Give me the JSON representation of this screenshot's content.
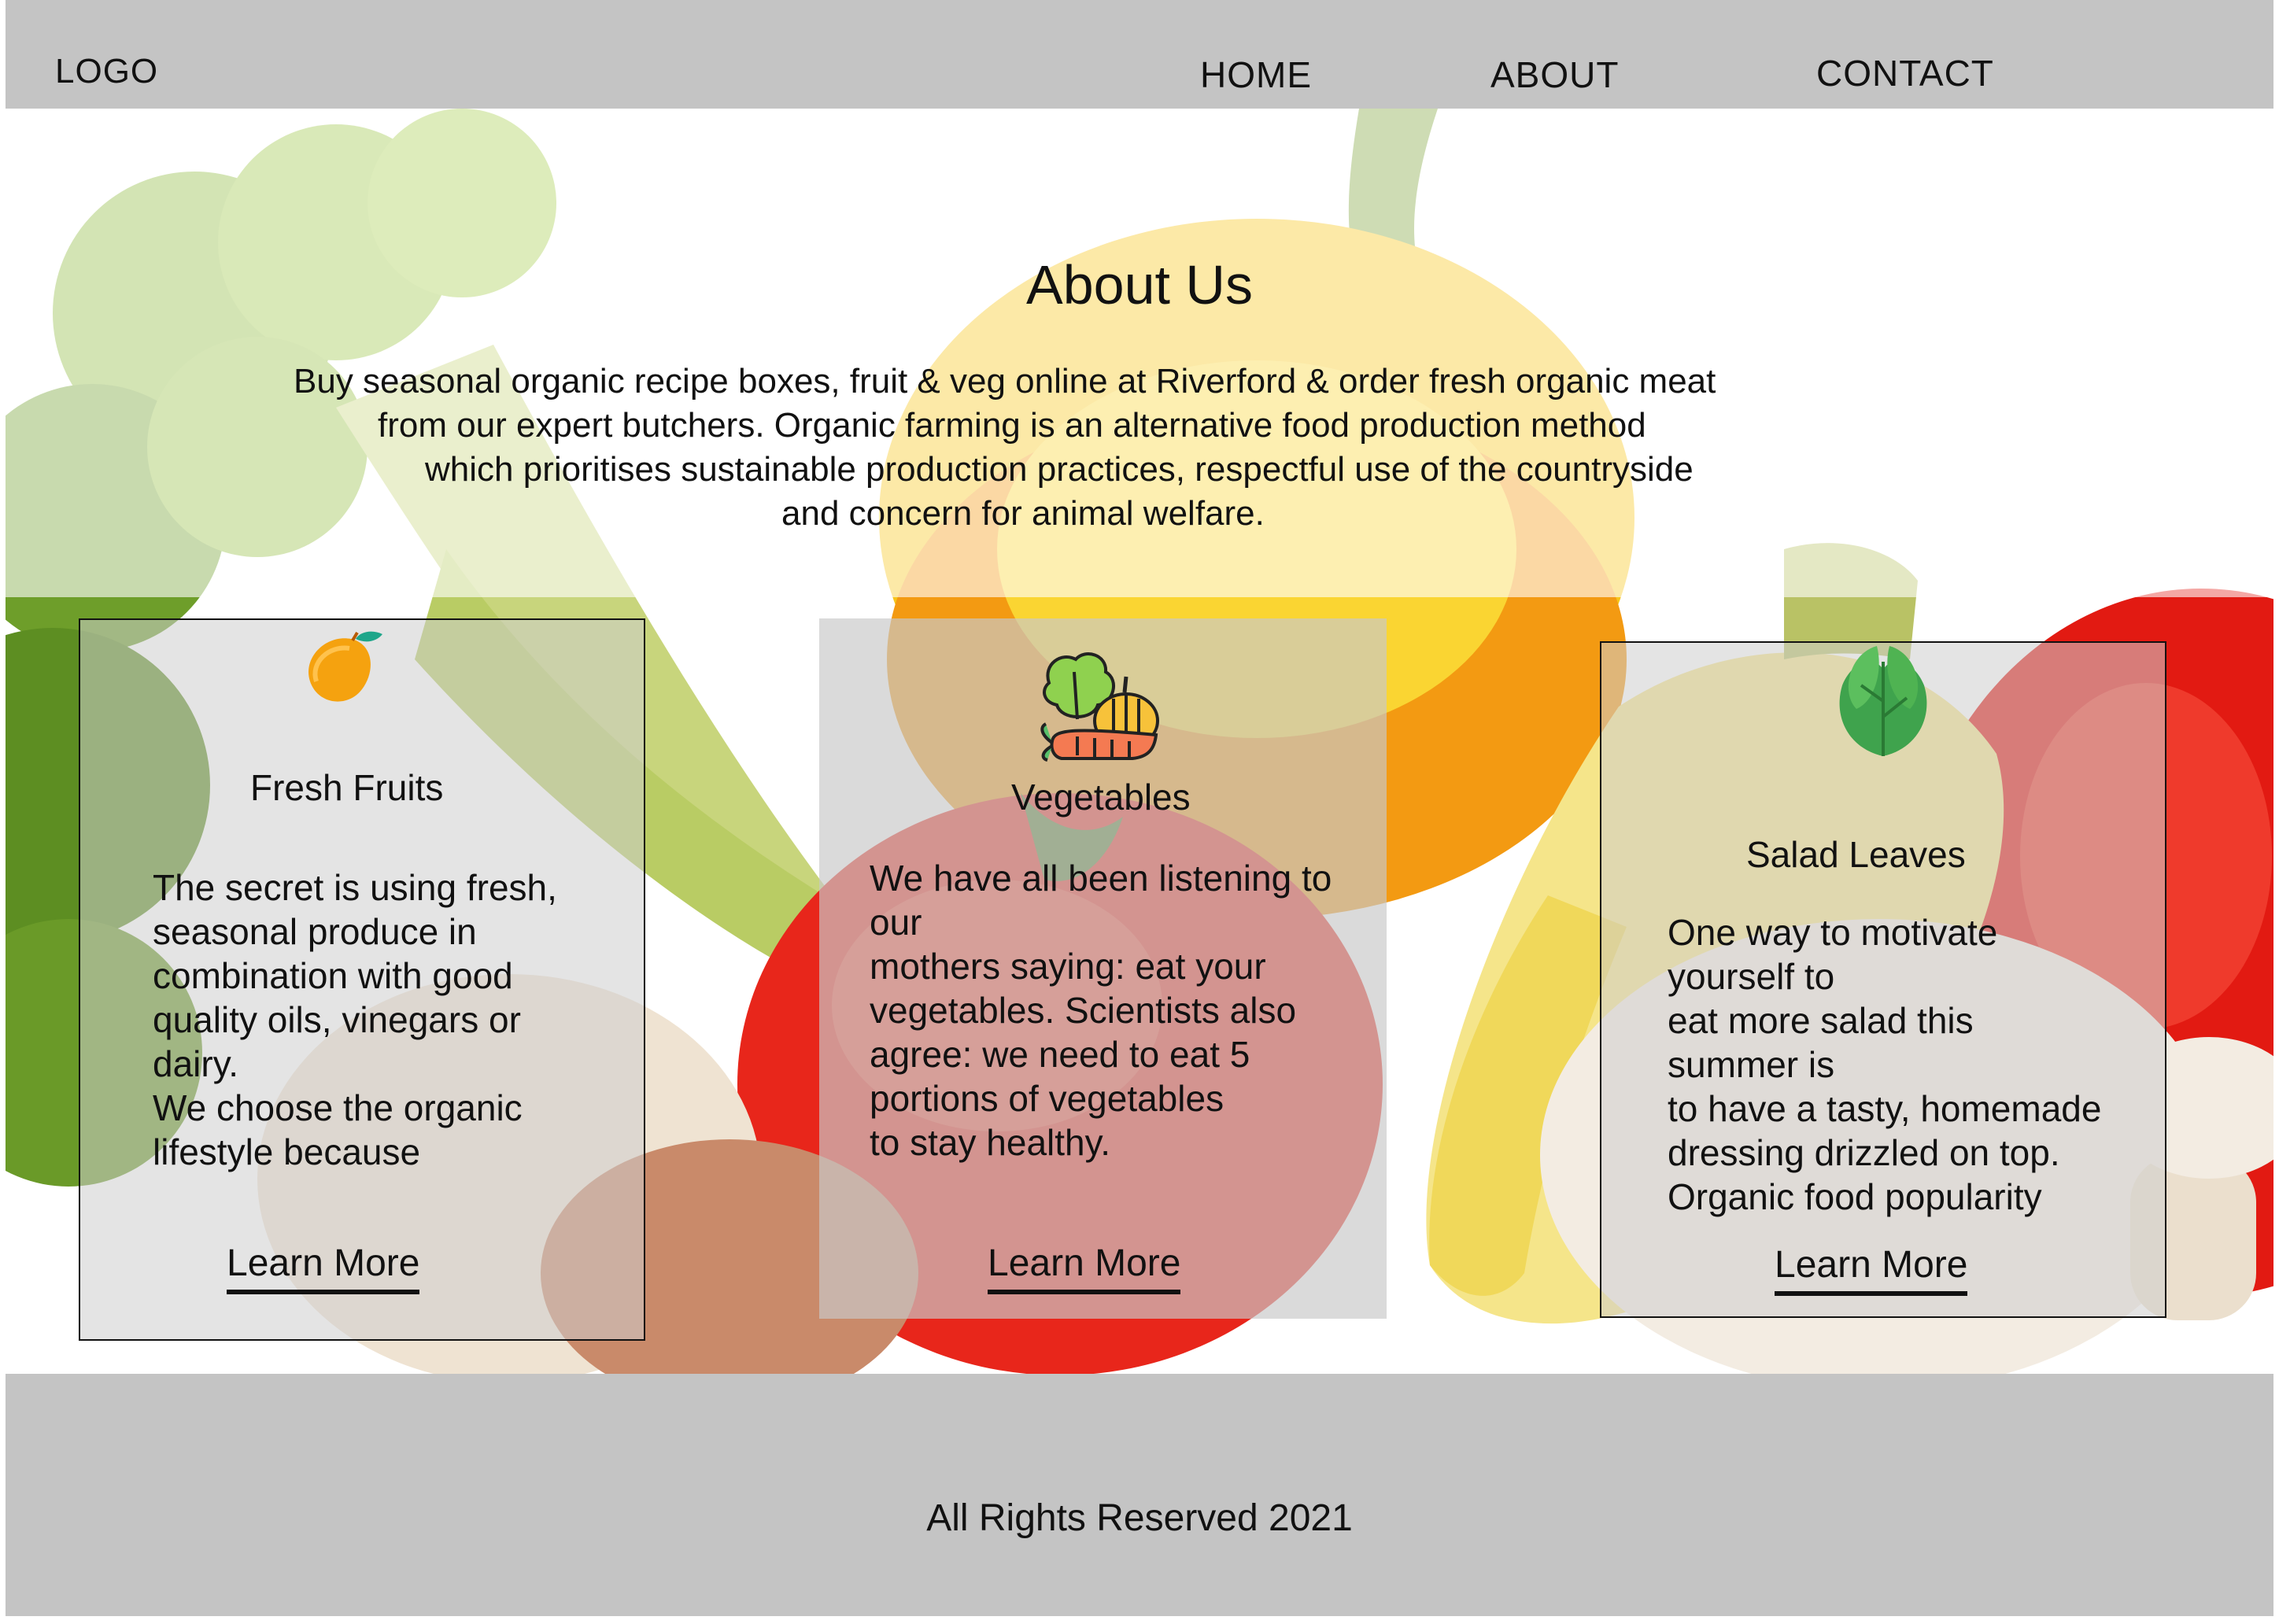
{
  "header": {
    "logo": "LOGO",
    "nav": [
      "HOME",
      "ABOUT",
      "CONTACT"
    ]
  },
  "hero": {
    "title": "About Us",
    "lines": [
      "Buy seasonal organic recipe boxes, fruit & veg online at Riverford & order fresh organic meat",
      "from our expert butchers. Organic farming is an alternative food production method",
      "which prioritises sustainable production practices, respectful use of the countryside",
      "and concern for animal welfare."
    ]
  },
  "cards": [
    {
      "icon": "mango-icon",
      "title": "Fresh Fruits",
      "text": "The secret is using fresh,\nseasonal produce in\ncombination with good\nquality oils, vinegars or\ndairy.\nWe choose the organic\nlifestyle because",
      "link": "Learn More"
    },
    {
      "icon": "vegetables-icon",
      "title": "Vegetables",
      "text": "We have all been listening to\nour\nmothers saying: eat your\nvegetables. Scientists also\nagree: we need to eat 5\nportions of vegetables\nto stay healthy.",
      "link": "Learn More"
    },
    {
      "icon": "salad-leaves-icon",
      "title": "Salad Leaves",
      "text": "One way to motivate\nyourself to\neat more salad this\nsummer is\nto have a tasty, homemade\ndressing drizzled on top.\nOrganic food popularity",
      "link": "Learn More"
    }
  ],
  "footer": {
    "copyright": "All Rights Reserved 2021"
  },
  "colors": {
    "header_bg": "#c4c4c4",
    "footer_bg": "#c4c4c4",
    "text": "#111111"
  }
}
